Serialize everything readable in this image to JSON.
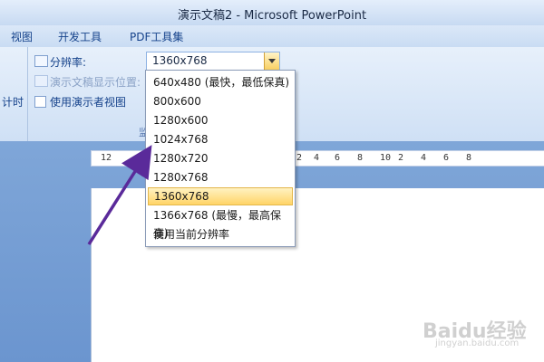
{
  "window": {
    "title": "演示文稿2 - Microsoft PowerPoint"
  },
  "menu": {
    "items": [
      "视图",
      "开发工具",
      "PDF工具集"
    ]
  },
  "ribbon": {
    "left_partial_label": "计时",
    "resolution_label": "分辨率:",
    "display_location_label": "演示文稿显示位置:",
    "presenter_view_label": "使用演示者视图",
    "group_label_partial": "监",
    "resolution_value": "1360x768"
  },
  "dropdown": {
    "options": [
      "640x480 (最快，最低保真)",
      "800x600",
      "1280x600",
      "1024x768",
      "1280x720",
      "1280x768",
      "1360x768",
      "1366x768 (最慢，最高保真)",
      "使用当前分辨率"
    ],
    "selected_index": 6
  },
  "ruler": {
    "ticks": [
      "12",
      "2",
      "4",
      "6",
      "8",
      "10",
      "2",
      "4",
      "6",
      "8"
    ]
  },
  "watermark": {
    "brand": "Baidu经验",
    "sub": "jingyan.baidu.com"
  },
  "colors": {
    "accent": "#ffd467",
    "arrow": "#5a2a9a"
  }
}
